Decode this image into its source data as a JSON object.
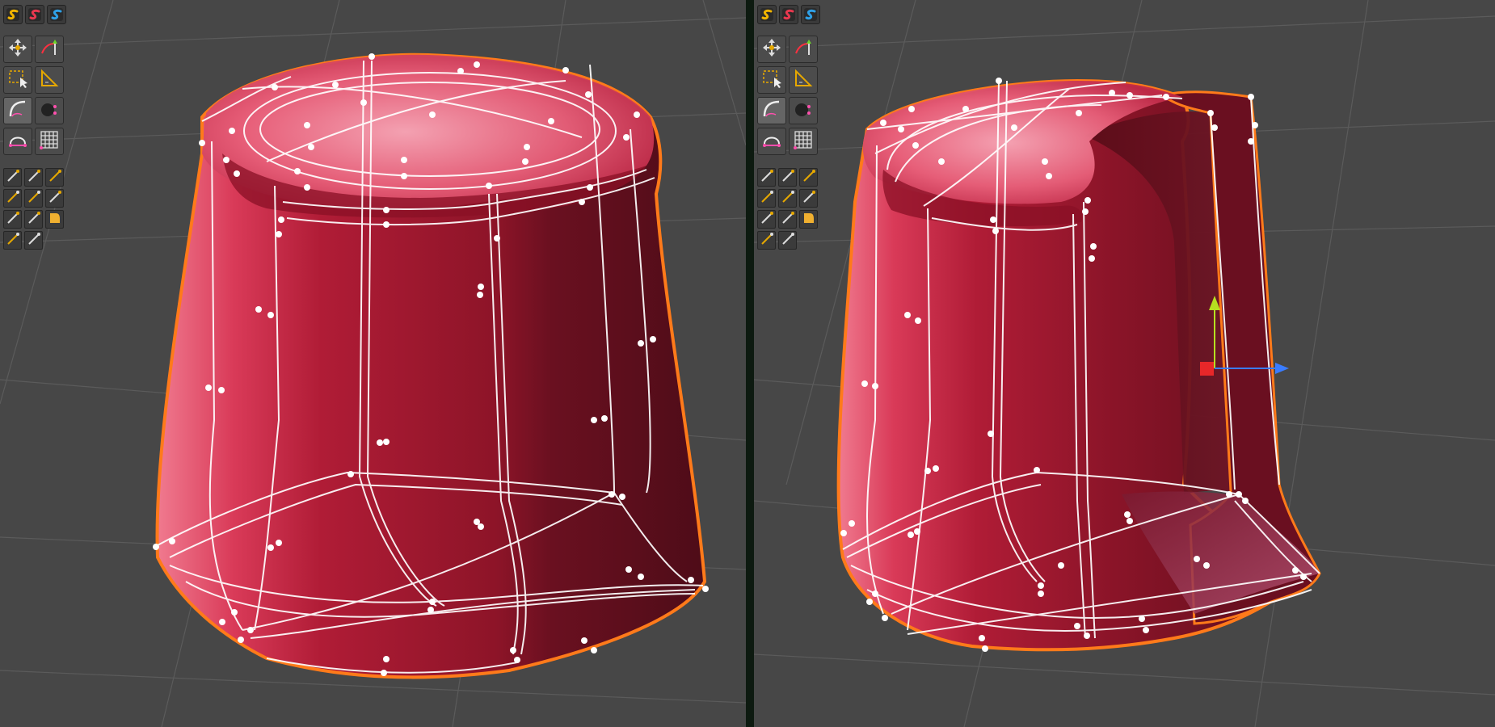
{
  "colors": {
    "background": "#474747",
    "grid": "#5a5a5a",
    "surface": "#a0182c",
    "surface_dark": "#5a1020",
    "surface_light": "#e8506a",
    "outline": "#ff7a1a",
    "wire": "#ffffff",
    "gizmo_x": "#3a7cff",
    "gizmo_y": "#b6e020",
    "gizmo_z": "#ff2a2a"
  },
  "viewports": [
    {
      "id": "left",
      "shape": "closed-surface"
    },
    {
      "id": "right",
      "shape": "opened-surface",
      "gizmo": true
    }
  ],
  "toolbar": {
    "modes": [
      {
        "name": "curve-mode-yellow-icon",
        "color": "#f0b400"
      },
      {
        "name": "curve-mode-red-icon",
        "color": "#e8384f"
      },
      {
        "name": "curve-mode-blue-icon",
        "color": "#2fa0e6"
      }
    ],
    "main_tools": [
      "move-tool-icon",
      "draw-curve-tool-icon",
      "select-box-tool-icon",
      "measure-tool-icon",
      "bezier-tool-icon",
      "sculpt-tool-icon",
      "bridge-tool-icon",
      "grid-tool-icon"
    ],
    "curve_tools": [
      "pen-tool-icon",
      "pen-add-tool-icon",
      "arc-tool-icon",
      "brush-tool-icon",
      "line-tool-icon",
      "blend-tool-icon",
      "split-tool-icon",
      "trim-tool-icon",
      "fillet-tool-icon",
      "pencil-tool-icon",
      "knife-tool-icon"
    ]
  }
}
